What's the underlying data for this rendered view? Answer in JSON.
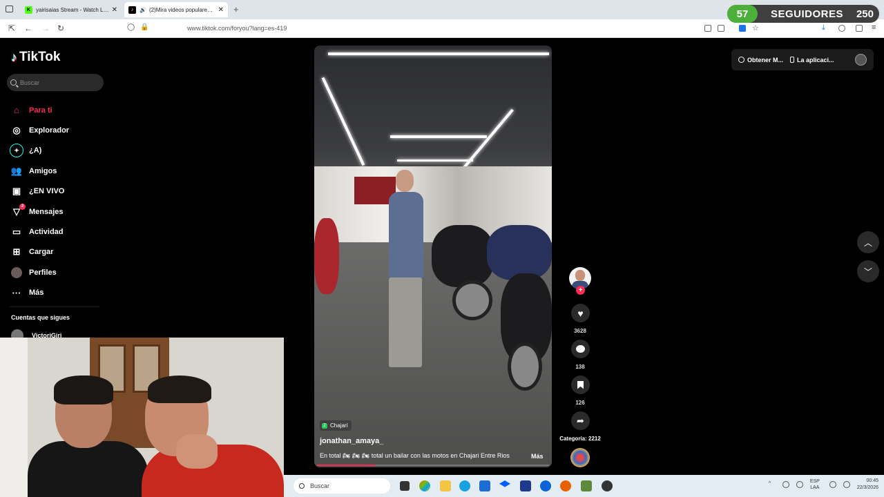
{
  "browser": {
    "tabs": [
      {
        "title": "yairisaias Stream - Watch Live o",
        "favicon": "K",
        "favicon_color": "#53fc18",
        "active": false
      },
      {
        "title": "(2)Mira videos populares sc",
        "favicon": "♪",
        "favicon_color": "#000000",
        "active": true
      }
    ],
    "url": "www.tiktok.com/foryou?lang=es-419"
  },
  "followers_overlay": {
    "count": "57",
    "label": "SEGUIDORES",
    "goal": "250",
    "accent": "#4caf3a"
  },
  "tiktok": {
    "logo": "TikTok",
    "search_placeholder": "Buscar",
    "nav": [
      {
        "label": "Para ti",
        "icon": "home-icon",
        "active": true
      },
      {
        "label": "Explorador",
        "icon": "compass-icon"
      },
      {
        "label": "¿A)",
        "icon": "ai-icon"
      },
      {
        "label": "Amigos",
        "icon": "friends-icon"
      },
      {
        "label": "¿EN VIVO",
        "icon": "live-icon"
      },
      {
        "label": "Mensajes",
        "icon": "messages-icon",
        "badge": "2"
      },
      {
        "label": "Actividad",
        "icon": "activity-icon"
      },
      {
        "label": "Cargar",
        "icon": "upload-icon"
      },
      {
        "label": "Perfiles",
        "icon": "profile-icon"
      },
      {
        "label": "Más",
        "icon": "more-icon"
      }
    ],
    "following_header": "Cuentas que sigues",
    "following_user": "VictorjGiri",
    "accent": "#fe2c55",
    "top_right": {
      "get_coins": "Obtener M...",
      "app": "La aplicaci..."
    },
    "video": {
      "location": "Chajarí",
      "author": "jonathan_amaya_",
      "caption": "En total 🏍 🏍 🏍 total un bailar con las motos en Chajari Entre Rios",
      "more": "Más",
      "progress": 0.25
    },
    "actions": {
      "likes": "3628",
      "comments": "138",
      "saves": "126",
      "category": "Categoría: 2212"
    }
  },
  "taskbar": {
    "search_placeholder": "Buscar",
    "lang_line1": "ESP",
    "lang_line2": "LAA",
    "time": "00:45",
    "date": "22/3/2026"
  }
}
